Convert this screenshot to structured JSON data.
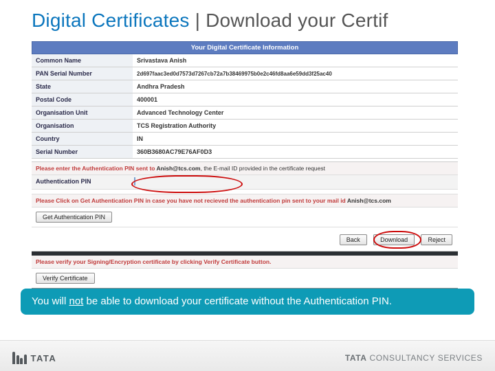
{
  "title": {
    "part1": "Digital Certificates",
    "sep": " | ",
    "part2": "Download your Certif"
  },
  "panel": {
    "banner": "Your Digital Certificate Information",
    "rows": [
      {
        "label": "Common Name",
        "value": "Srivastava Anish"
      },
      {
        "label": "PAN Serial Number",
        "value": "2d697faac3ed0d7573d7267cb72a7b38469975b0e2c46fd8aa6e59dd3f25ac40"
      },
      {
        "label": "State",
        "value": "Andhra Pradesh"
      },
      {
        "label": "Postal Code",
        "value": "400001"
      },
      {
        "label": "Organisation Unit",
        "value": "Advanced Technology Center"
      },
      {
        "label": "Organisation",
        "value": "TCS Registration Authority"
      },
      {
        "label": "Country",
        "value": "IN"
      },
      {
        "label": "Serial Number",
        "value": "360B3680AC79E76AF0D3"
      }
    ],
    "authPrompt": {
      "prefix": "Please enter the Authentication PIN sent to ",
      "email": "Anish@tcs.com",
      "suffix": ", the E-mail ID provided in the certificate request"
    },
    "pinLabel": "Authentication PIN",
    "getPinPrompt": {
      "prefix": "Please Click on Get Authentication PIN in case you have not recieved the authentication pin sent to your mail id ",
      "email": "Anish@tcs.com",
      "suffix": ""
    },
    "buttons": {
      "getPin": "Get Authentication PIN",
      "back": "Back",
      "download": "Download",
      "reject": "Reject",
      "verify": "Verify Certificate"
    },
    "verifyPrompt": "Please verify your Signing/Encryption certificate by clicking Verify Certificate button."
  },
  "tip": {
    "pre": "You will ",
    "underlined": "not",
    "post": " be able to download your certificate without the Authentication PIN."
  },
  "footer": {
    "tata": "TATA",
    "brand_bold": "TATA",
    "brand_light1": " CONSULTANCY ",
    "brand_light2": "SERVICES"
  }
}
